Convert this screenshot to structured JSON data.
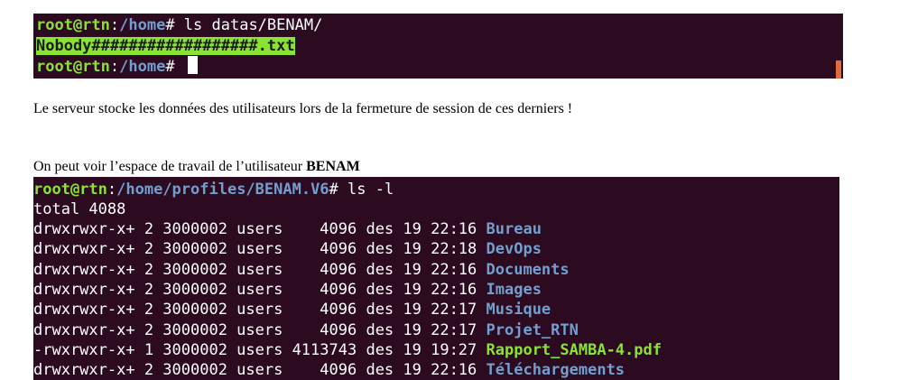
{
  "terminal1": {
    "prompt_user": "root@rtn",
    "prompt_sep": ":",
    "line1_path": "/home",
    "line1_cmd": "# ls datas/BENAM/",
    "output_file": "Nobody##################.txt",
    "line3_path": "/home",
    "line3_cmd": "# "
  },
  "paragraph1": "Le serveur stocke les données des utilisateurs lors de la fermeture de session de ces derniers !",
  "paragraph2": {
    "text": "On peut voir l’espace de travail de l’utilisateur ",
    "bold": "BENAM"
  },
  "terminal2": {
    "prompt_user": "root@rtn",
    "prompt_sep": ":",
    "path": "/home/profiles/BENAM.V6",
    "cmd": "# ls -l",
    "total": "total 4088",
    "entries": [
      {
        "meta": "drwxrwxr-x+ 2 3000002 users    4096 des 19 22:16 ",
        "name": "Bureau",
        "kind": "dir"
      },
      {
        "meta": "drwxrwxr-x+ 2 3000002 users    4096 des 19 22:18 ",
        "name": "DevOps",
        "kind": "dir"
      },
      {
        "meta": "drwxrwxr-x+ 2 3000002 users    4096 des 19 22:16 ",
        "name": "Documents",
        "kind": "dir"
      },
      {
        "meta": "drwxrwxr-x+ 2 3000002 users    4096 des 19 22:16 ",
        "name": "Images",
        "kind": "dir"
      },
      {
        "meta": "drwxrwxr-x+ 2 3000002 users    4096 des 19 22:17 ",
        "name": "Musique",
        "kind": "dir"
      },
      {
        "meta": "drwxrwxr-x+ 2 3000002 users    4096 des 19 22:17 ",
        "name": "Projet_RTN",
        "kind": "dir"
      },
      {
        "meta": "-rwxrwxr-x+ 1 3000002 users 4113743 des 19 19:27 ",
        "name": "Rapport_SAMBA-4.pdf",
        "kind": "file"
      },
      {
        "meta": "drwxrwxr-x+ 2 3000002 users    4096 des 19 22:16 ",
        "name": "Téléchargements",
        "kind": "dir"
      }
    ]
  },
  "colors": {
    "terminal_bg": "#2c0a1f",
    "prompt_green": "#8ae234",
    "path_blue": "#729fcf",
    "scroll_orange": "#e06c3c"
  }
}
